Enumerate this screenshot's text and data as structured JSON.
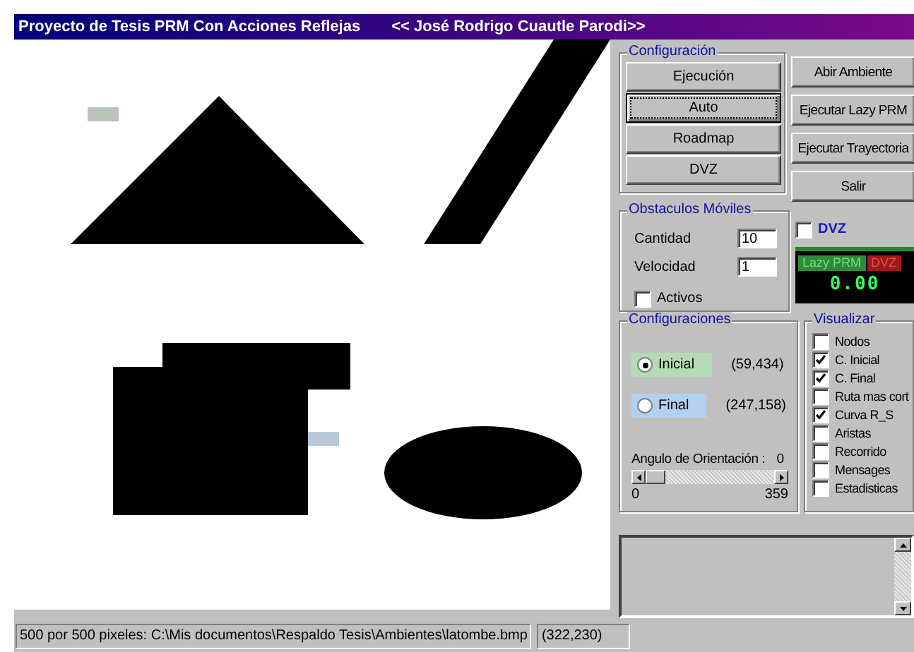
{
  "window": {
    "title": "Proyecto de Tesis PRM Con Acciones Reflejas",
    "subtitle": "<< José Rodrigo Cuautle Parodi>>"
  },
  "configuracion": {
    "title": "Configuración",
    "buttons": [
      {
        "label": "Ejecución",
        "focused": false
      },
      {
        "label": "Auto",
        "focused": true
      },
      {
        "label": "Roadmap",
        "focused": false
      },
      {
        "label": "DVZ",
        "focused": false
      }
    ]
  },
  "actions": [
    "Abir Ambiente",
    "Ejecutar Lazy PRM",
    "Ejecutar Trayectoria",
    "Salir"
  ],
  "obstaculos": {
    "title": "Obstaculos Móviles",
    "fields": [
      {
        "label": "Cantidad",
        "value": "10"
      },
      {
        "label": "Velocidad",
        "value": "1"
      }
    ],
    "activos": {
      "label": "Activos",
      "checked": false
    }
  },
  "dvz": {
    "label": "DVZ",
    "checked": false
  },
  "display": {
    "tabs": [
      {
        "label": "Lazy PRM",
        "selected": true,
        "color": "#2e8b3a"
      },
      {
        "label": "DVZ",
        "selected": false,
        "color": "#a01818"
      }
    ],
    "value": "0.00"
  },
  "configuraciones": {
    "title": "Configuraciones",
    "radios": [
      {
        "label": "Inicial",
        "selected": true,
        "color": "#b4dcb4",
        "coords": "(59,434)"
      },
      {
        "label": "Final",
        "selected": false,
        "color": "#b4d0f0",
        "coords": "(247,158)"
      }
    ],
    "angle": {
      "label": "Angulo de Orientación :",
      "value": "0",
      "min": "0",
      "max": "359"
    }
  },
  "visualizar": {
    "title": "Visualizar",
    "items": [
      {
        "label": "Nodos",
        "checked": false
      },
      {
        "label": "C. Inicial",
        "checked": true
      },
      {
        "label": "C.  Final",
        "checked": true
      },
      {
        "label": "Ruta mas cort",
        "checked": false
      },
      {
        "label": "Curva  R_S",
        "checked": true
      },
      {
        "label": "Aristas",
        "checked": false
      },
      {
        "label": "Recorrido",
        "checked": false
      },
      {
        "label": "Mensages",
        "checked": false
      },
      {
        "label": "Estadisticas",
        "checked": false
      }
    ]
  },
  "status_bar": {
    "path": "500 por 500 pixeles: C:\\Mis documentos\\Respaldo Tesis\\Ambientes\\latombe.bmp",
    "coords": "(322,230)"
  }
}
